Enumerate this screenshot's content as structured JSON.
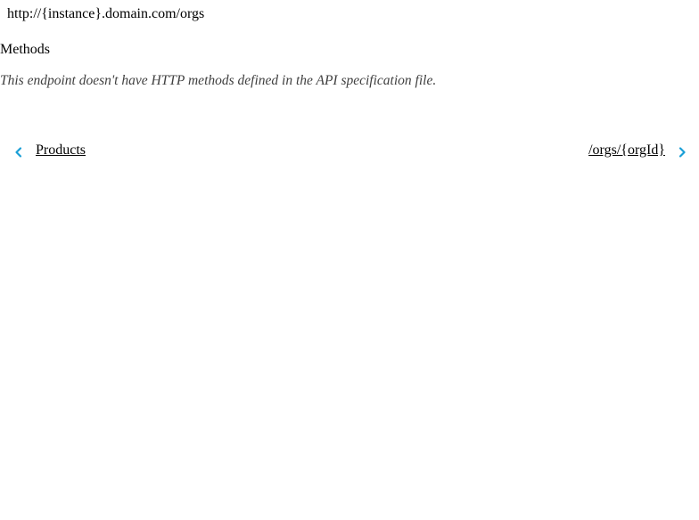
{
  "endpoint": {
    "url": "http://{instance}.domain.com/orgs"
  },
  "methods": {
    "heading": "Methods",
    "note": "This endpoint doesn't have HTTP methods defined in the API specification file."
  },
  "pager": {
    "previous_label": "Products",
    "next_label": "/orgs/{orgId}",
    "previous_icon": "chevron-left-icon",
    "next_icon": "chevron-right-icon",
    "icon_color": "#1a9fd6"
  }
}
